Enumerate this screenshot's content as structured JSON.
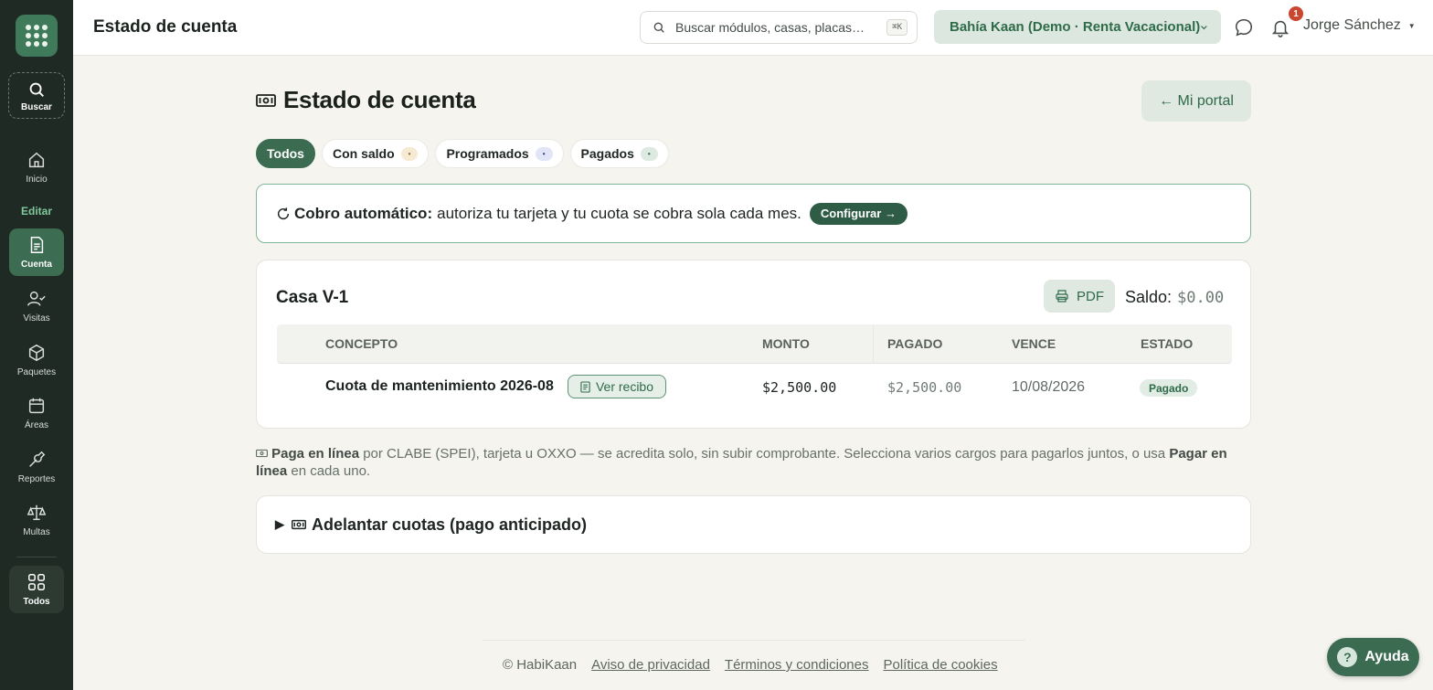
{
  "sidebar": {
    "search_label": "Buscar",
    "section_label": "Editar",
    "items": [
      {
        "label": "Inicio",
        "icon": "home-icon"
      },
      {
        "label": "Cuenta",
        "icon": "document-icon"
      },
      {
        "label": "Visitas",
        "icon": "visitor-icon"
      },
      {
        "label": "Paquetes",
        "icon": "package-icon"
      },
      {
        "label": "Áreas",
        "icon": "calendar-icon"
      },
      {
        "label": "Reportes",
        "icon": "wrench-icon"
      },
      {
        "label": "Multas",
        "icon": "scale-icon"
      },
      {
        "label": "Todos",
        "icon": "grid-icon"
      }
    ]
  },
  "topbar": {
    "title": "Estado de cuenta",
    "search_placeholder": "Buscar módulos, casas, placas…",
    "search_shortcut": "⌘K",
    "org": "Bahía Kaan (Demo · Renta Vacacional)",
    "notifications": "1",
    "user": "Jorge Sánchez"
  },
  "page": {
    "title": "Estado de cuenta",
    "portal_button": "← Mi portal",
    "filters": [
      {
        "label": "Todos",
        "count": ""
      },
      {
        "label": "Con saldo",
        "count": "•"
      },
      {
        "label": "Programados",
        "count": "•"
      },
      {
        "label": "Pagados",
        "count": "•"
      }
    ],
    "auto_charge": {
      "title": "Cobro automático:",
      "text": "autoriza tu tarjeta y tu cuota se cobra sola cada mes.",
      "button": "Configurar →"
    },
    "house": {
      "name": "Casa V-1",
      "pdf_button": "PDF",
      "saldo_label": "Saldo:",
      "saldo_amount": "$0.00",
      "columns": [
        "CONCEPTO",
        "MONTO",
        "PAGADO",
        "VENCE",
        "ESTADO"
      ],
      "rows": [
        {
          "concepto": "Cuota de mantenimiento 2026-08",
          "recibo": "Ver recibo",
          "monto": "$2,500.00",
          "pagado": "$2,500.00",
          "vence": "10/08/2026",
          "estado": "Pagado"
        }
      ]
    },
    "info": {
      "bold1": "Paga en línea",
      "text1": " por CLABE (SPEI), tarjeta u OXXO — se acredita solo, sin subir comprobante. Selecciona varios cargos para pagarlos juntos, o usa ",
      "bold2": "Pagar en línea",
      "text2": " en cada uno."
    },
    "advance": "Adelantar cuotas (pago anticipado)"
  },
  "footer": {
    "copyright": "© HabiKaan",
    "links": [
      "Aviso de privacidad",
      "Términos y condiciones",
      "Política de cookies"
    ]
  },
  "help_button": "Ayuda",
  "colors": {
    "accent": "#3b6b51",
    "sidebar": "#1f2a24",
    "background": "#f5f4ef"
  }
}
